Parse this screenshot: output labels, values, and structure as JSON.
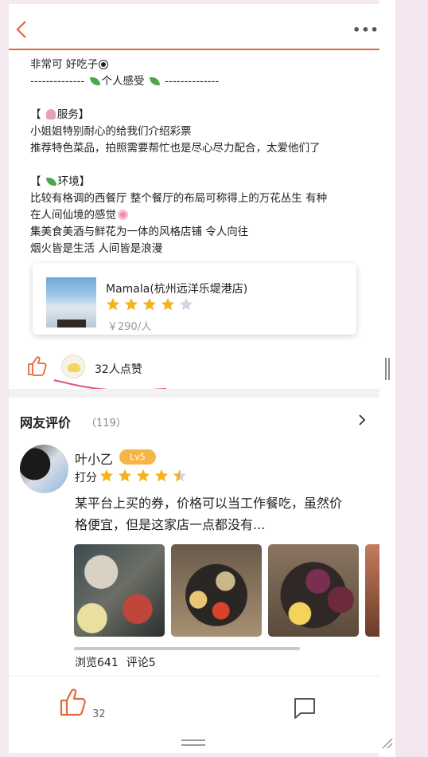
{
  "post": {
    "lines": [
      "非常可 好吃子",
      "--------------",
      "个人感受",
      "--------------",
      "【",
      "服务】",
      "小姐姐特别耐心的给我们介绍彩票",
      "推荐特色菜品，拍照需要帮忙也是尽心尽力配合，太爱他们了",
      "【",
      "环境】",
      "比较有格调的西餐厅 整个餐厅的布局可称得上的万花丛生 有种",
      "在人间仙境的感觉",
      "集美食美酒与鲜花为一体的风格店铺 令人向往",
      "烟火皆是生活 人间皆是浪漫"
    ]
  },
  "shop": {
    "name": "Mamala(杭州远洋乐堤港店)",
    "rating": 4,
    "price": "￥290/人"
  },
  "likes": {
    "count_text": "32人点赞"
  },
  "reviews": {
    "title": "网友评价",
    "count": "（119）",
    "item": {
      "user": "叶小乙",
      "level": "Lv5",
      "score_label": "打分",
      "rating": 4.5,
      "text_line1": "某平台上买的券，价格可以当工作餐吃，虽然价",
      "text_line2": "格便宜，但是这家店一点都没有...",
      "views": "浏览641",
      "comments": "评论5"
    }
  },
  "bottom_bar": {
    "like_count": "32"
  },
  "colors": {
    "accent": "#e06a3b",
    "star": "#f5b21d",
    "star_empty": "#cfd6e3",
    "badge": "#f5b548"
  },
  "icons": [
    "back-icon",
    "more-icon",
    "thumbs-up-icon",
    "chevron-right-icon",
    "comment-icon",
    "star-icon"
  ]
}
